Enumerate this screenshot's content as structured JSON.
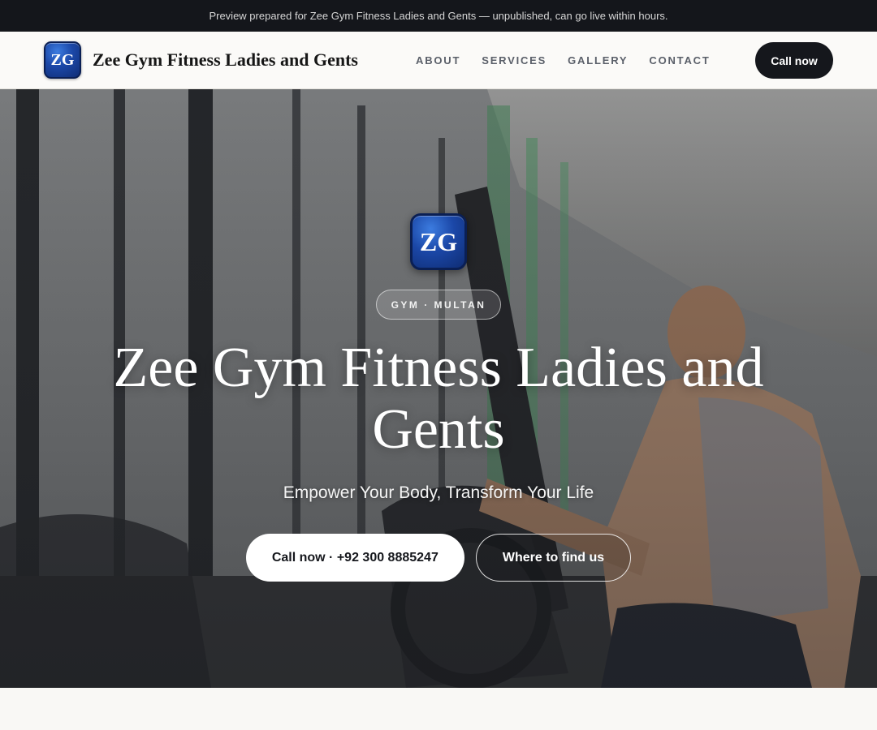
{
  "banner": {
    "text": "Preview prepared for Zee Gym Fitness Ladies and Gents — unpublished, can go live within hours."
  },
  "nav": {
    "logo_initials": "ZG",
    "brand_name": "Zee Gym Fitness Ladies and Gents",
    "links": [
      "ABOUT",
      "SERVICES",
      "GALLERY",
      "CONTACT"
    ],
    "cta_label": "Call now"
  },
  "hero": {
    "logo_initials": "ZG",
    "tag": "GYM · MULTAN",
    "title": "Zee Gym Fitness Ladies and Gents",
    "subtitle": "Empower Your Body, Transform Your Life",
    "primary_button": "Call now · +92 300 8885247",
    "secondary_button": "Where to find us"
  },
  "colors": {
    "banner_bg": "#14161b",
    "nav_bg": "#fbfaf8",
    "cta_bg": "#15171c",
    "logo_blue": "#1b47a7",
    "accent_green": "#3fbf6a"
  }
}
